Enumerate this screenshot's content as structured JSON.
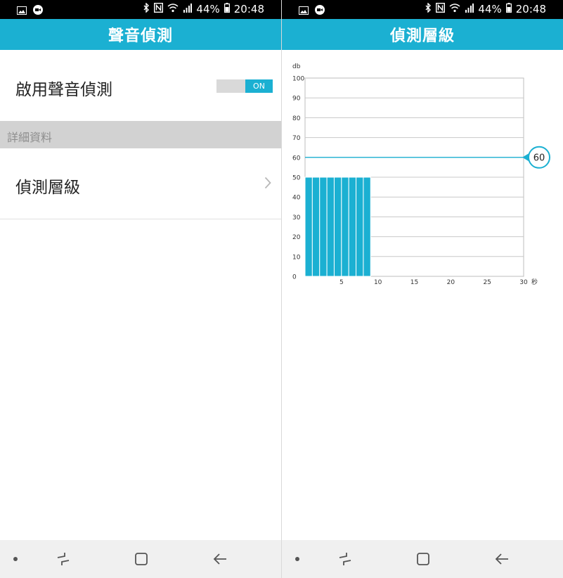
{
  "status_bar": {
    "battery_text": "44%",
    "time": "20:48",
    "left_icons": [
      "gallery-icon",
      "video-record-icon"
    ],
    "right_icons": [
      "bluetooth-icon",
      "nfc-icon",
      "wifi-icon",
      "signal-icon",
      "battery-icon"
    ]
  },
  "left": {
    "title": "聲音偵測",
    "enable_label": "啟用聲音偵測",
    "toggle_label": "ON",
    "section_header": "詳細資料",
    "level_label": "偵測層級"
  },
  "right": {
    "title": "偵測層級"
  },
  "nav": {
    "buttons": [
      "dot-icon",
      "recent-apps-icon",
      "home-icon",
      "back-icon"
    ]
  },
  "colors": {
    "accent": "#1bb0d2",
    "status_bar": "#000000",
    "section_bg": "#d2d2d2",
    "nav_bg": "#f0f0f0"
  },
  "chart_data": {
    "type": "bar",
    "ylabel": "db",
    "xlabel": "秒",
    "ylim": [
      0,
      100
    ],
    "xlim": [
      0,
      30
    ],
    "yticks": [
      0,
      10,
      20,
      30,
      40,
      50,
      60,
      70,
      80,
      90,
      100
    ],
    "xticks": [
      5,
      10,
      15,
      20,
      25,
      30
    ],
    "x": [
      1,
      2,
      3,
      4,
      5,
      6,
      7,
      8,
      9
    ],
    "values": [
      50,
      50,
      50,
      50,
      50,
      50,
      50,
      50,
      50
    ],
    "threshold": 60,
    "threshold_label": "60",
    "grid": true
  }
}
